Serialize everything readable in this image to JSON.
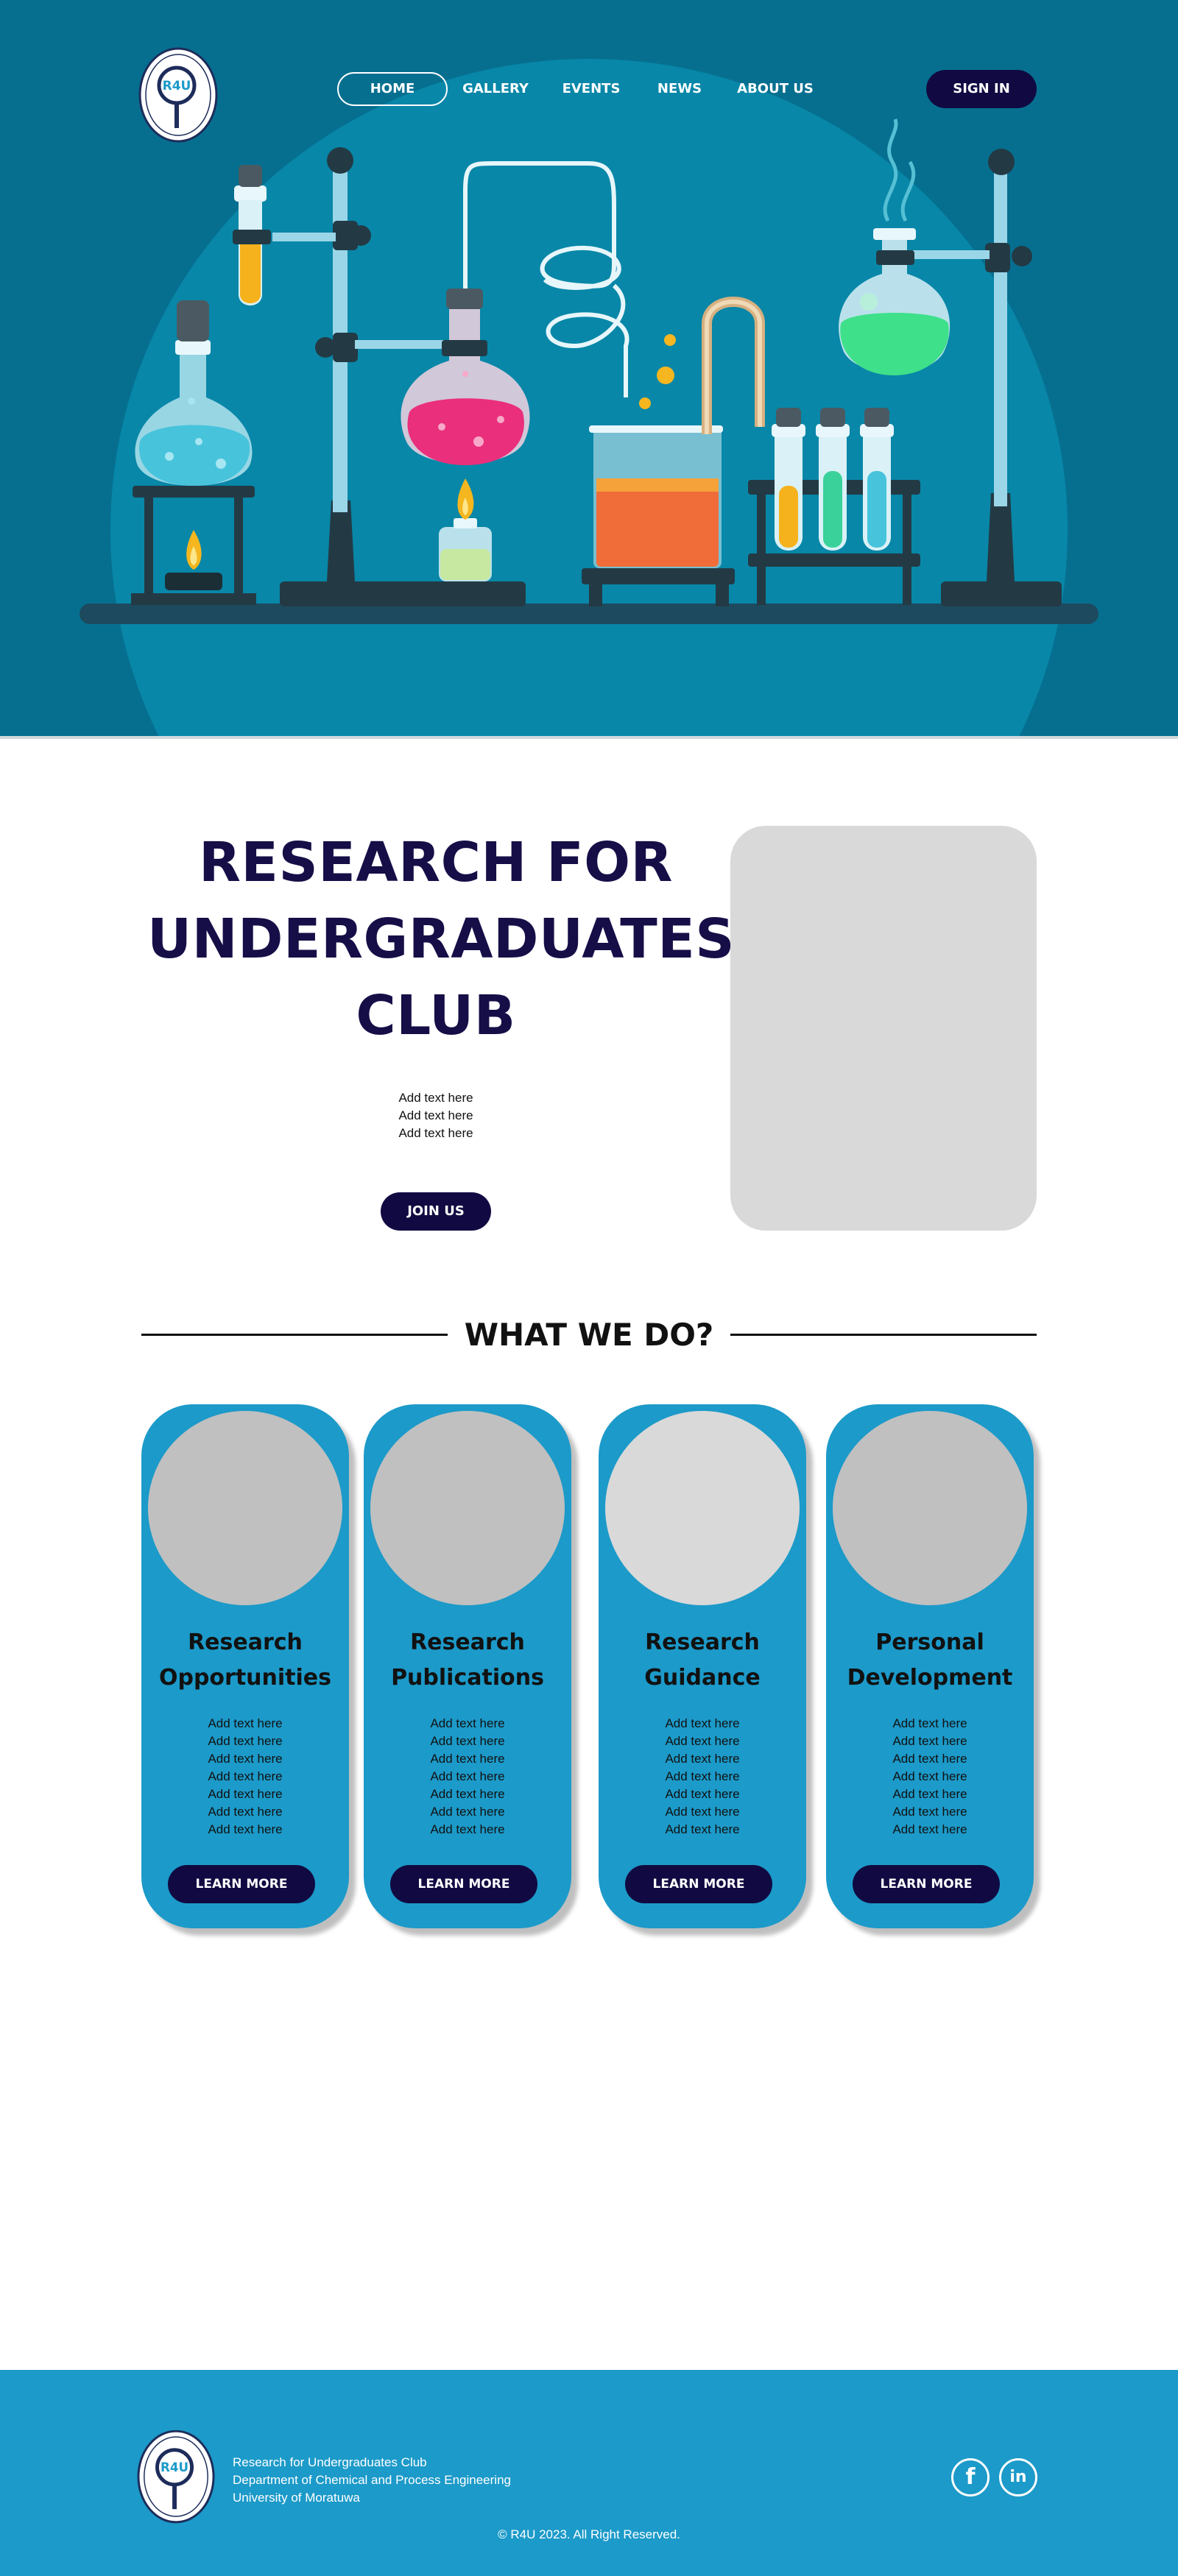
{
  "header": {
    "nav": [
      {
        "label": "HOME",
        "active": true
      },
      {
        "label": "GALLERY",
        "active": false
      },
      {
        "label": "EVENTS",
        "active": false
      },
      {
        "label": "NEWS",
        "active": false
      },
      {
        "label": "ABOUT US",
        "active": false
      }
    ],
    "sign_in_label": "SIGN IN",
    "logo_text": "R4U"
  },
  "intro": {
    "title_lines": [
      "RESEARCH FOR",
      "UNDERGRADUATES",
      "CLUB"
    ],
    "text_lines": [
      "Add text here",
      "Add text here",
      "Add text here"
    ],
    "join_label": "JOIN US"
  },
  "what_we_do": {
    "heading": "WHAT WE DO?",
    "cards": [
      {
        "title_lines": [
          "Research",
          "Opportunities"
        ],
        "text_lines": [
          "Add text here",
          "Add text here",
          "Add text here",
          "Add text here",
          "Add text here",
          "Add text here",
          "Add text here"
        ],
        "button": "LEARN MORE"
      },
      {
        "title_lines": [
          "Research",
          "Publications"
        ],
        "text_lines": [
          "Add text here",
          "Add text here",
          "Add text here",
          "Add text here",
          "Add text here",
          "Add text here",
          "Add text here"
        ],
        "button": "LEARN MORE"
      },
      {
        "title_lines": [
          "Research",
          "Guidance"
        ],
        "text_lines": [
          "Add text here",
          "Add text here",
          "Add text here",
          "Add text here",
          "Add text here",
          "Add text here",
          "Add text here"
        ],
        "button": "LEARN MORE"
      },
      {
        "title_lines": [
          "Personal",
          "Development"
        ],
        "text_lines": [
          "Add text here",
          "Add text here",
          "Add text here",
          "Add text here",
          "Add text here",
          "Add text here",
          "Add text here"
        ],
        "button": "LEARN MORE"
      }
    ]
  },
  "footer": {
    "lines": [
      "Research for Undergraduates Club",
      "Department of Chemical and Process Engineering",
      "University of Moratuwa"
    ],
    "copyright": "© R4U 2023. All Right Reserved.",
    "social": [
      {
        "icon": "facebook-icon",
        "glyph": "f"
      },
      {
        "icon": "linkedin-icon",
        "glyph": "in"
      }
    ]
  },
  "colors": {
    "hero_bg": "#066f90",
    "accent_blue": "#1c9ac9",
    "navy": "#110a42",
    "title_navy": "#160e47",
    "placeholder_gray": "#d9d9d9"
  }
}
